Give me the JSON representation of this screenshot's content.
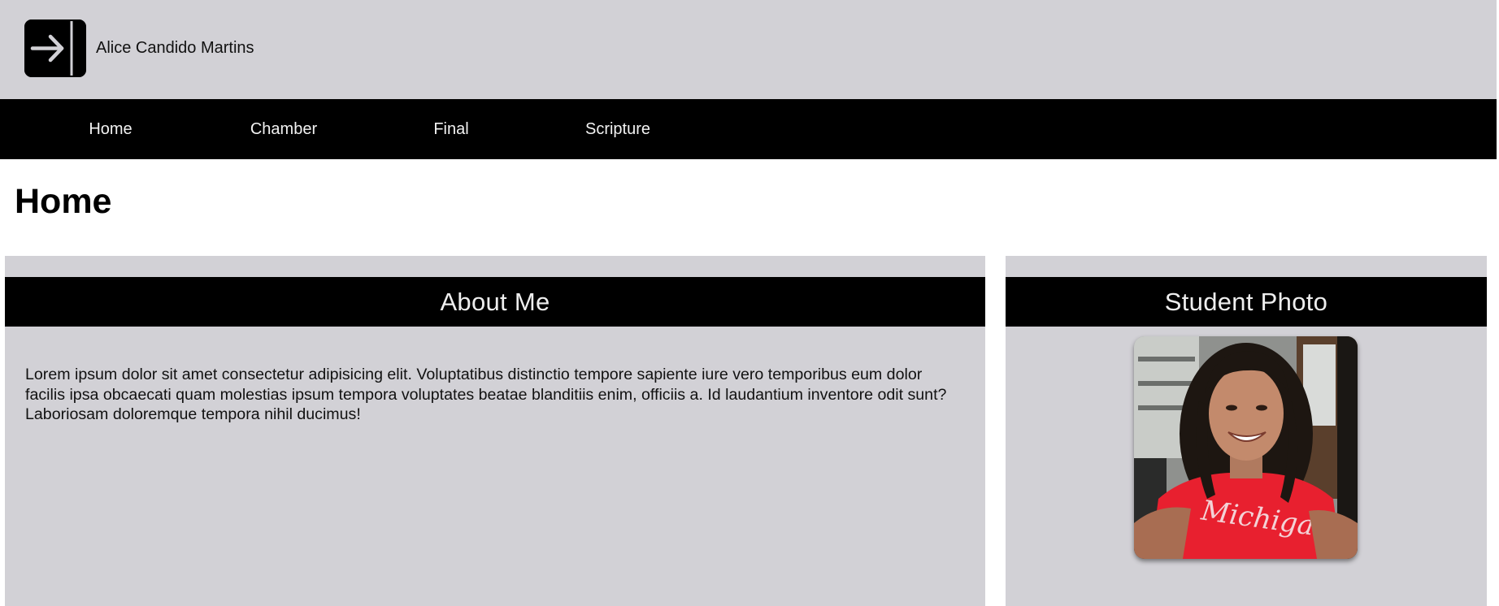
{
  "header": {
    "logo_icon": "arrow-right-to-bracket-icon",
    "site_name": "Alice Candido Martins"
  },
  "nav": {
    "items": [
      {
        "label": "Home"
      },
      {
        "label": "Chamber"
      },
      {
        "label": "Final"
      },
      {
        "label": "Scripture"
      }
    ]
  },
  "main": {
    "page_title": "Home",
    "about": {
      "heading": "About Me",
      "text": "Lorem ipsum dolor sit amet consectetur adipisicing elit. Voluptatibus distinctio tempore sapiente iure vero temporibus eum dolor facilis ipsa obcaecati quam molestias ipsum tempora voluptates beatae blanditiis enim, officiis a. Id laudantium inventore odit sunt? Laboriosam doloremque tempora nihil ducimus!"
    },
    "photo": {
      "heading": "Student Photo",
      "shirt_text": "Michigan"
    }
  },
  "colors": {
    "header_bg": "#d2d1d6",
    "nav_bg": "#000000",
    "card_bg": "#d2d1d6",
    "card_head_bg": "#000000",
    "shirt": "#e8202f"
  }
}
